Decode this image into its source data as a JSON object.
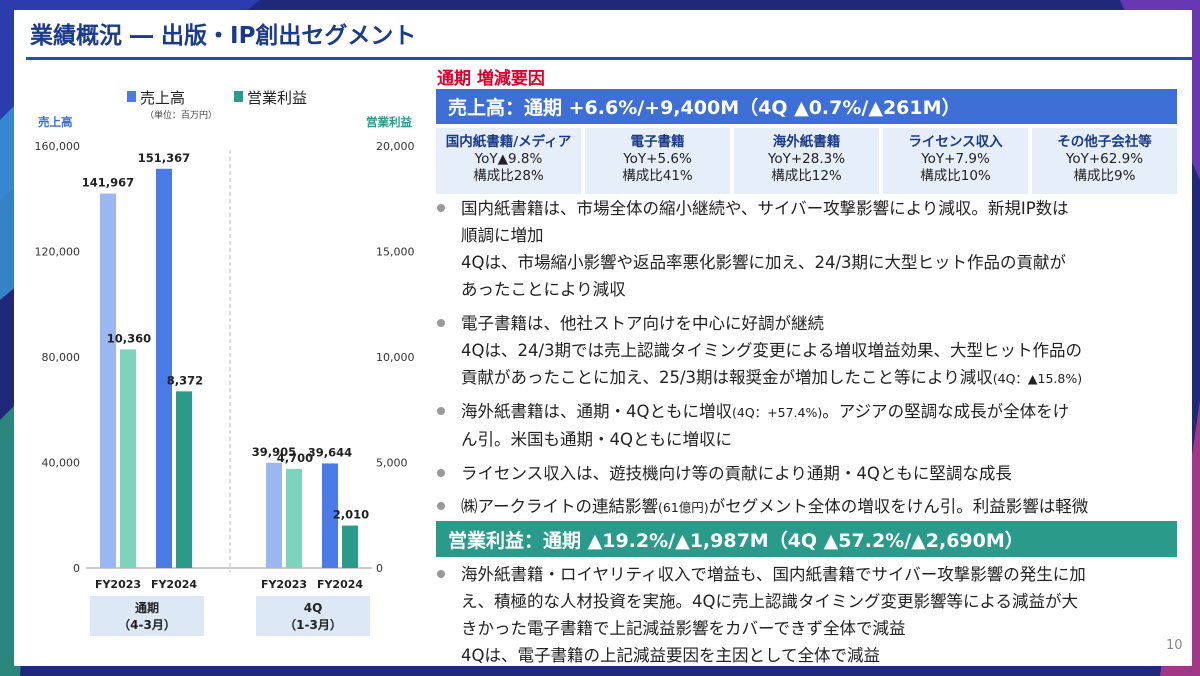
{
  "title": "業績概況 ― 出版・IP創出セグメント",
  "page_number": "10",
  "colors": {
    "title": "#1a3a8a",
    "accent_blue": "#3d6fd6",
    "accent_teal": "#2a9a8a",
    "red": "#e0002a"
  },
  "chart": {
    "legend": {
      "sales": "売上高",
      "profit": "営業利益",
      "unit": "（単位：百万円）"
    },
    "left_axis_title": "売上高",
    "right_axis_title": "営業利益",
    "left_ticks": [
      "160,000",
      "120,000",
      "80,000",
      "40,000",
      "0"
    ],
    "right_ticks": [
      "20,000",
      "15,000",
      "10,000",
      "5,000",
      "0"
    ],
    "group_labels": [
      {
        "line1": "通期",
        "line2": "（4-3月）"
      },
      {
        "line1": "4Q",
        "line2": "（1-3月）"
      }
    ],
    "x_labels": [
      "FY2023",
      "FY2024",
      "FY2023",
      "FY2024"
    ]
  },
  "chart_data": {
    "type": "bar",
    "categories": [
      "FY2023",
      "FY2024",
      "FY2023",
      "FY2024"
    ],
    "groups": [
      "通期（4-3月）",
      "4Q（1-3月）"
    ],
    "series": [
      {
        "name": "売上高",
        "axis": "left",
        "values": [
          141967,
          151367,
          39905,
          39644
        ],
        "labels": [
          "141,967",
          "151,367",
          "39,905",
          "39,644"
        ]
      },
      {
        "name": "営業利益",
        "axis": "right",
        "values": [
          10360,
          8372,
          4700,
          2010
        ],
        "labels": [
          "10,360",
          "8,372",
          "4,700",
          "2,010"
        ]
      }
    ],
    "ylim_left": [
      0,
      160000
    ],
    "ylim_right": [
      0,
      20000
    ],
    "ylabel": "売上高",
    "y2label": "営業利益"
  },
  "right": {
    "section_heading": "通期 増減要因",
    "sales_band": "売上高：通期 +6.6%/+9,400M（4Q ▲0.7%/▲261M）",
    "segments": [
      {
        "name": "国内紙書籍/メディア",
        "yoy": "YoY▲9.8%",
        "share": "構成比28%"
      },
      {
        "name": "電子書籍",
        "yoy": "YoY+5.6%",
        "share": "構成比41%"
      },
      {
        "name": "海外紙書籍",
        "yoy": "YoY+28.3%",
        "share": "構成比12%"
      },
      {
        "name": "ライセンス収入",
        "yoy": "YoY+7.9%",
        "share": "構成比10%"
      },
      {
        "name": "その他子会社等",
        "yoy": "YoY+62.9%",
        "share": "構成比9%"
      }
    ],
    "bullets": [
      {
        "l1": "国内紙書籍は、市場全体の縮小継続や、サイバー攻撃影響により減収。新規IP数は",
        "l2": "順調に増加",
        "l3": "4Qは、市場縮小影響や返品率悪化影響に加え、24/3期に大型ヒット作品の貢献が",
        "l4": "あったことにより減収"
      },
      {
        "l1": "電子書籍は、他社ストア向けを中心に好調が継続",
        "l2": "4Qは、24/3期では売上認識タイミング変更による増収増益効果、大型ヒット作品の",
        "l3": "貢献があったことに加え、25/3期は報奨金が増加したこと等により減収",
        "l3s": "(4Q：▲15.8%)"
      },
      {
        "l1": "海外紙書籍は、通期・4Qともに増収",
        "l1s": "(4Q：+57.4%)",
        "l1b": "。アジアの堅調な成長が全体をけ",
        "l2": "ん引。米国も通期・4Qともに増収に"
      },
      {
        "l1": "ライセンス収入は、遊技機向け等の貢献により通期・4Qともに堅調な成長"
      },
      {
        "l1a": "㈱アークライトの連結影響",
        "l1s": "(61億円)",
        "l1b": "がセグメント全体の増収をけん引。利益影響は軽微"
      }
    ],
    "profit_band": "営業利益：通期 ▲19.2%/▲1,987M（4Q ▲57.2%/▲2,690M）",
    "profit_bullet": {
      "l1": "海外紙書籍・ロイヤリティ収入で増益も、国内紙書籍でサイバー攻撃影響の発生に加",
      "l2": "え、積極的な人材投資を実施。4Qに売上認識タイミング変更影響等による減益が大",
      "l3": "きかった電子書籍で上記減益影響をカバーできず全体で減益",
      "l4": "4Qは、電子書籍の上記減益要因を主因として全体で減益"
    }
  }
}
